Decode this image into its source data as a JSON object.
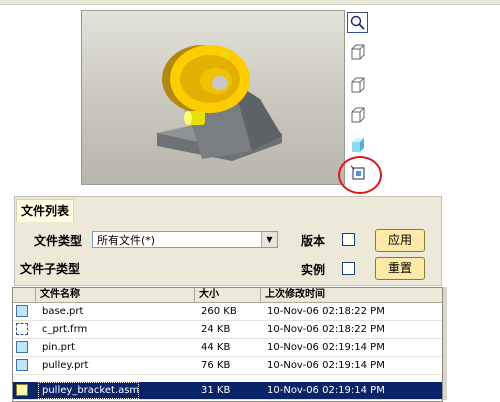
{
  "file_list_tab": "文件列表",
  "form": {
    "file_type_label": "文件类型",
    "file_type_value": "所有文件(*)",
    "file_subtype_label": "文件子类型",
    "version_label": "版本",
    "instance_label": "实例",
    "apply_button": "应用",
    "reset_button": "重置"
  },
  "table": {
    "columns": [
      "文件名称",
      "大小",
      "上次修改时间"
    ],
    "rows": [
      {
        "name": "base.prt",
        "size": "260 KB",
        "modified": "10-Nov-06 02:18:22 PM",
        "icon": "part-file-icon"
      },
      {
        "name": "c_prt.frm",
        "size": "24 KB",
        "modified": "10-Nov-06 02:18:22 PM",
        "icon": "format-file-icon"
      },
      {
        "name": "pin.prt",
        "size": "44 KB",
        "modified": "10-Nov-06 02:19:14 PM",
        "icon": "part-file-icon"
      },
      {
        "name": "pulley.prt",
        "size": "76 KB",
        "modified": "10-Nov-06 02:19:14 PM",
        "icon": "part-file-icon"
      },
      {
        "name": "pulley_bracket.asm",
        "size": "31 KB",
        "modified": "10-Nov-06 02:19:14 PM",
        "icon": "assembly-file-icon",
        "selected": true
      }
    ]
  },
  "preview_tools": [
    "zoom-fit-icon",
    "view-cube-icon",
    "view-cube-icon",
    "view-cube-icon",
    "shaded-cube-icon",
    "reorient-icon"
  ]
}
